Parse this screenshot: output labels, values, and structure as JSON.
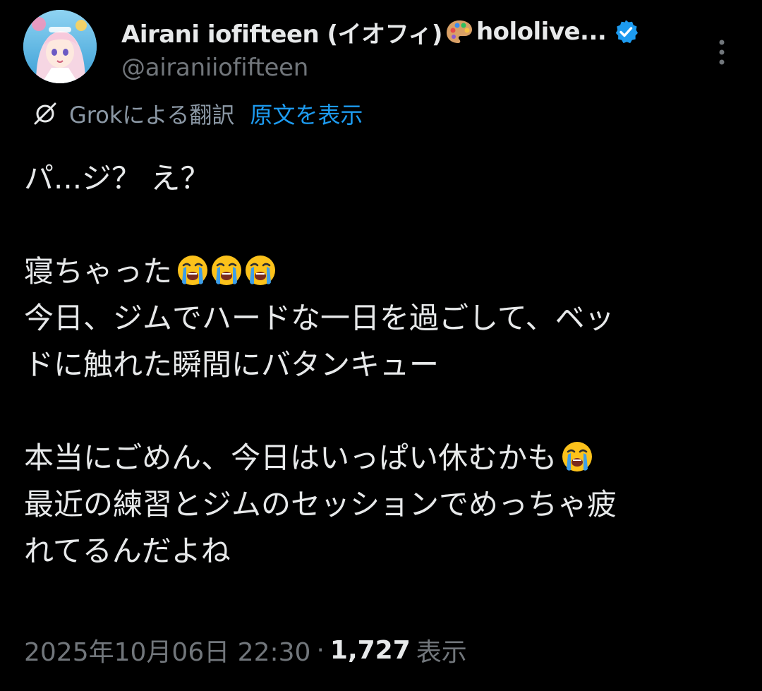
{
  "author": {
    "display_name_part1": "Airani iofifteen (イオフィ)",
    "display_name_part2": "hololive...",
    "name_emoji": "palette-emoji",
    "verified": true,
    "handle": "@airaniiofifteen"
  },
  "translation": {
    "label": "Grokによる翻訳",
    "show_original": "原文を表示"
  },
  "post": {
    "line1": "パ...ジ？ え？",
    "line2": "寝ちゃった",
    "line2_emoji": [
      "loudly-crying-face-emoji",
      "loudly-crying-face-emoji",
      "loudly-crying-face-emoji"
    ],
    "line3": "今日、ジムでハードな一日を過ごして、ベッ",
    "line4": "ドに触れた瞬間にバタンキュー",
    "line5": "本当にごめん、今日はいっぱい休むかも",
    "line5_emoji": [
      "loudly-crying-face-emoji"
    ],
    "line6": "最近の練習とジムのセッションでめっちゃ疲",
    "line7": "れてるんだよね"
  },
  "meta": {
    "timestamp": "2025年10月06日 22:30",
    "separator": "·",
    "views_count": "1,727",
    "views_label": "表示"
  },
  "colors": {
    "background": "#000000",
    "text_primary": "#e7e9ea",
    "text_secondary": "#71767b",
    "link": "#1d9bf0",
    "verified_badge": "#1d9bf0"
  }
}
